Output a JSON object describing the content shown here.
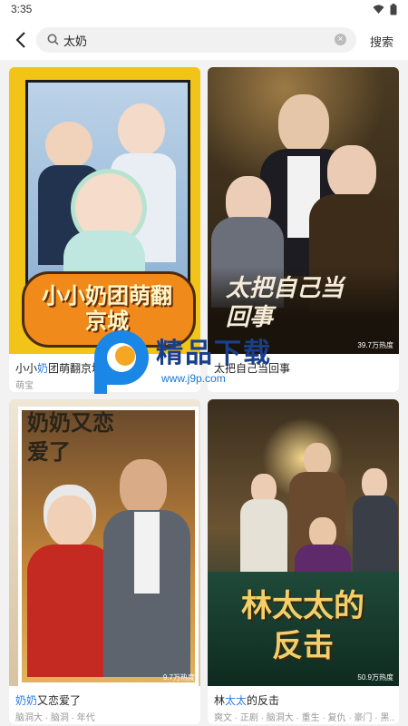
{
  "status": {
    "time": "3:35"
  },
  "search": {
    "query": "太奶",
    "button": "搜索"
  },
  "watermark": {
    "text": "精品下载",
    "url": "www.j9p.com"
  },
  "cards": [
    {
      "title_pre": "小小",
      "title_hl": "奶",
      "title_post": "团萌翻京城",
      "tags": "萌宝",
      "poster_text": "小小奶团萌翻京城",
      "heat": ""
    },
    {
      "title_pre": "",
      "title_hl": "",
      "title_post": "太把自己当回事",
      "tags": "",
      "poster_text": "太把自己当回事",
      "heat": "39.7万热度"
    },
    {
      "title_pre": "",
      "title_hl": "奶奶",
      "title_post": "又恋爱了",
      "tags": "脑洞大 · 脑洞 · 年代",
      "poster_text": "奶奶又恋爱了",
      "heat": "9.7万热度"
    },
    {
      "title_pre": "林",
      "title_hl": "太太",
      "title_post": "的反击",
      "tags": "爽文 · 正剧 · 脑洞大 · 重生 · 复仇 · 豪门 · 黑...",
      "poster_text": "林太太的反击",
      "heat": "50.9万热度"
    }
  ]
}
